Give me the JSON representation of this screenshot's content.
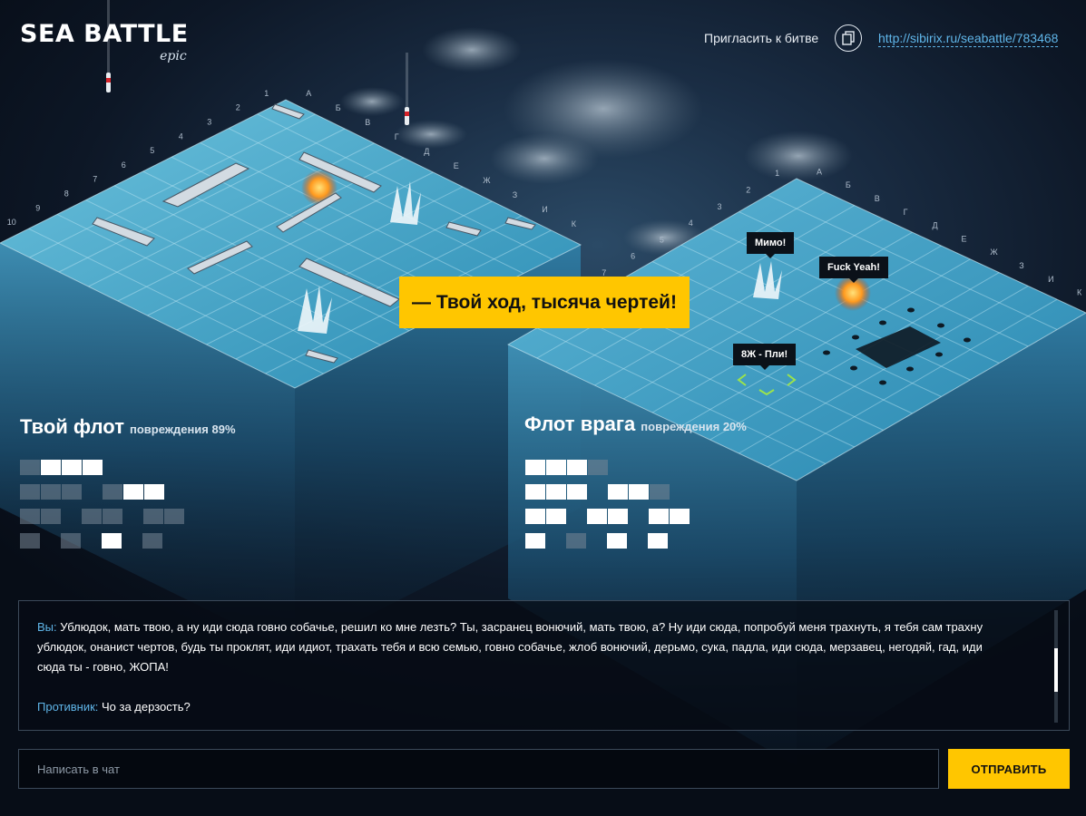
{
  "header": {
    "logo_title": "SEA BATTLE",
    "logo_subtitle": "epic",
    "invite_label": "Пригласить к битве",
    "copy_icon": "copy-icon",
    "invite_link": "http://sibirix.ru/seabattle/783468"
  },
  "turn_banner": "— Твой ход, тысяча чертей!",
  "board_labels": {
    "numbers": [
      "1",
      "2",
      "3",
      "4",
      "5",
      "6",
      "7",
      "8",
      "9",
      "10"
    ],
    "letters": [
      "А",
      "Б",
      "В",
      "Г",
      "Д",
      "Е",
      "Ж",
      "З",
      "И",
      "К"
    ]
  },
  "enemy_board": {
    "tooltips": {
      "miss": "Мимо!",
      "hit": "Fuck Yeah!",
      "aim": "8Ж - Пли!"
    }
  },
  "my_fleet": {
    "title": "Твой флот",
    "damage": "повреждения 89%",
    "rows": [
      [
        [
          "hit",
          "alive",
          "alive",
          "alive"
        ]
      ],
      [
        [
          "hit",
          "hit",
          "hit"
        ],
        [
          "hit",
          "alive",
          "alive"
        ]
      ],
      [
        [
          "hit",
          "hit"
        ],
        [
          "hit",
          "hit"
        ],
        [
          "hit",
          "hit"
        ]
      ],
      [
        [
          "hit"
        ],
        [
          "hit"
        ],
        [
          "alive"
        ],
        [
          "hit"
        ]
      ]
    ]
  },
  "enemy_fleet": {
    "title": "Флот врага",
    "damage": "повреждения 20%",
    "rows": [
      [
        [
          "alive",
          "alive",
          "alive",
          "hit"
        ]
      ],
      [
        [
          "alive",
          "alive",
          "alive"
        ],
        [
          "alive",
          "alive",
          "hit"
        ]
      ],
      [
        [
          "alive",
          "alive"
        ],
        [
          "alive",
          "alive"
        ],
        [
          "alive",
          "alive"
        ]
      ],
      [
        [
          "alive"
        ],
        [
          "hit"
        ],
        [
          "alive"
        ],
        [
          "alive"
        ]
      ]
    ]
  },
  "chat": {
    "messages": [
      {
        "author": "Вы:",
        "text": "Ублюдок, мать твою, а ну иди сюда говно собачье, решил ко мне лезть? Ты, засранец вонючий, мать твою, а? Ну иди сюда, попробуй меня трахнуть, я тебя сам трахну ублюдок, онанист чертов, будь ты проклят, иди идиот, трахать тебя и всю семью, говно собачье, жлоб вонючий, дерьмо, сука, падла, иди сюда, мерзавец, негодяй, гад, иди сюда ты - говно, ЖОПА!"
      },
      {
        "author": "Противник:",
        "text": "Чо за дерзость?"
      }
    ],
    "input_placeholder": "Написать в чат",
    "send_label": "ОТПРАВИТЬ"
  },
  "colors": {
    "accent": "#ffc600",
    "link": "#5fb5e8",
    "water": "#2f8fb6"
  }
}
